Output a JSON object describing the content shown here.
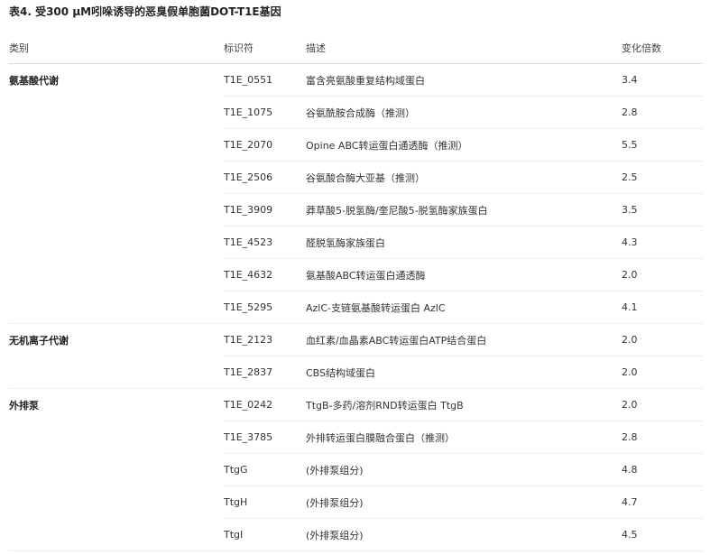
{
  "title": "表4. 受300 μM吲哚诱导的恶臭假单胞菌DOT-T1E基因",
  "headers": {
    "category": "类别",
    "id": "标识符",
    "desc": "描述",
    "fold": "变化倍数"
  },
  "rows": [
    {
      "category": "氨基酸代谢",
      "id": "T1E_0551",
      "desc": "富含亮氨酸重复结构域蛋白",
      "fold": "3.4"
    },
    {
      "category": "",
      "id": "T1E_1075",
      "desc": "谷氨酰胺合成酶（推测）",
      "fold": "2.8"
    },
    {
      "category": "",
      "id": "T1E_2070",
      "desc": "Opine ABC转运蛋白通透酶（推测）",
      "fold": "5.5"
    },
    {
      "category": "",
      "id": "T1E_2506",
      "desc": "谷氨酸合酶大亚基（推测）",
      "fold": "2.5"
    },
    {
      "category": "",
      "id": "T1E_3909",
      "desc": "莽草酸5-脱氢酶/奎尼酸5-脱氢酶家族蛋白",
      "fold": "3.5"
    },
    {
      "category": "",
      "id": "T1E_4523",
      "desc": "醛脱氢酶家族蛋白",
      "fold": "4.3"
    },
    {
      "category": "",
      "id": "T1E_4632",
      "desc": "氨基酸ABC转运蛋白通透酶",
      "fold": "2.0"
    },
    {
      "category": "",
      "id": "T1E_5295",
      "desc": "AzlC-支链氨基酸转运蛋白 AzlC",
      "fold": "4.1"
    },
    {
      "category": "无机离子代谢",
      "id": "T1E_2123",
      "desc": "血红素/血晶素ABC转运蛋白ATP结合蛋白",
      "fold": "2.0"
    },
    {
      "category": "",
      "id": "T1E_2837",
      "desc": "CBS结构域蛋白",
      "fold": "2.0"
    },
    {
      "category": "外排泵",
      "id": "T1E_0242",
      "desc": "TtgB-多药/溶剂RND转运蛋白 TtgB",
      "fold": "2.0"
    },
    {
      "category": "",
      "id": "T1E_3785",
      "desc": "外排转运蛋白膜融合蛋白（推测）",
      "fold": "2.8"
    },
    {
      "category": "",
      "id": "TtgG",
      "desc": "(外排泵组分)",
      "fold": "4.8"
    },
    {
      "category": "",
      "id": "TtgH",
      "desc": "(外排泵组分)",
      "fold": "4.7"
    },
    {
      "category": "",
      "id": "TtgI",
      "desc": "(外排泵组分)",
      "fold": "4.5"
    }
  ]
}
